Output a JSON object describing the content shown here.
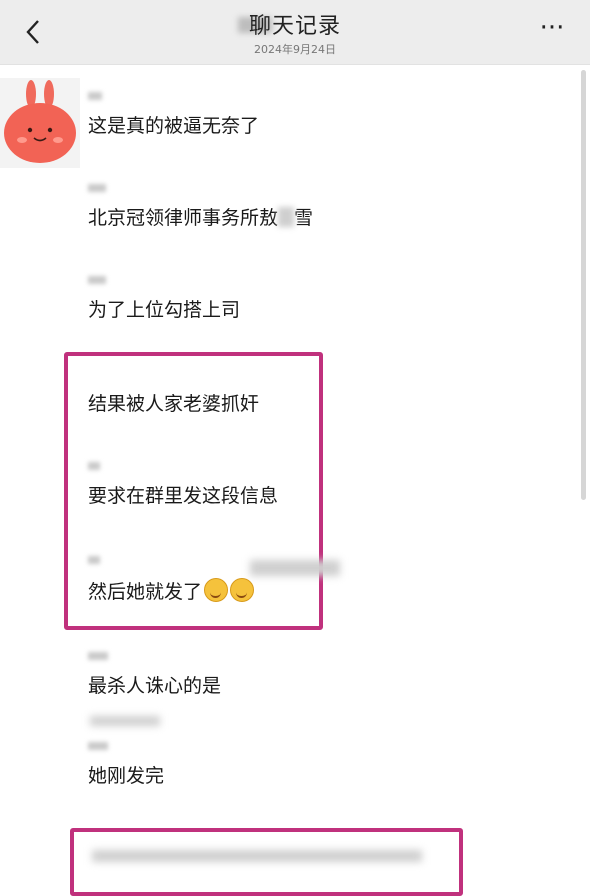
{
  "header": {
    "title": "聊天记录",
    "subtitle": "2024年9月24日"
  },
  "messages": [
    {
      "text": "这是真的被逼无奈了"
    },
    {
      "text": "北京冠领律师事务所敖"
    },
    {
      "text": "雪"
    },
    {
      "text": "为了上位勾搭上司"
    },
    {
      "text": "结果被人家老婆抓奸"
    },
    {
      "text": "要求在群里发这段信息"
    },
    {
      "text": "然后她就发了"
    },
    {
      "text": "最杀人诛心的是"
    },
    {
      "text": "她刚发完"
    }
  ],
  "colors": {
    "highlight": "#c0317d",
    "topbar": "#ededed"
  }
}
